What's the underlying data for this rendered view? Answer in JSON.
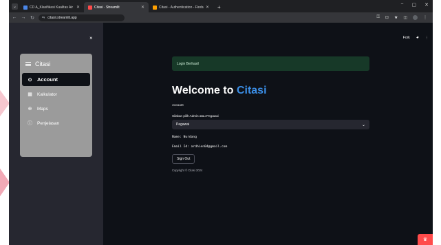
{
  "browser": {
    "tabs": [
      {
        "label": "CD A_Klasifikasi Kualitas Air Su..",
        "fav_color": "#4a86e8",
        "active": false
      },
      {
        "label": "Citasi · Streamlit",
        "fav_color": "#ff4b4b",
        "active": true
      },
      {
        "label": "Citasi - Authentication - Fireba",
        "fav_color": "#ffa000",
        "active": false
      }
    ],
    "new_tab": "+",
    "url": "citasii.streamlit.app"
  },
  "sidebar": {
    "close": "×",
    "menu_title": "Citasi",
    "items": [
      {
        "label": "Account",
        "icon": "account-circle-icon",
        "glyph": "⊙",
        "active": true
      },
      {
        "label": "Kalkulator",
        "icon": "calculator-icon",
        "glyph": "▦",
        "active": false
      },
      {
        "label": "Maps",
        "icon": "globe-icon",
        "glyph": "⊕",
        "active": false
      },
      {
        "label": "Penjelasan",
        "icon": "info-icon",
        "glyph": "ⓘ",
        "active": false
      }
    ]
  },
  "header": {
    "fork": "Fork"
  },
  "main": {
    "alert": "Login Berhasil",
    "title_prefix": "Welcome to ",
    "title_brand": "Citasi",
    "section": "Account",
    "status_label": "Silakan pilih Admin atau Pegawai",
    "status_value": "Pegawai",
    "name_line": "Name: Nurdang",
    "email_line": "Email Id: ardhien04@gmail.com",
    "sign_out": "Sign Out",
    "copyright": "Copyright © Citasi 2024"
  },
  "colors": {
    "app_bg": "#0e1117",
    "sidebar_bg": "#262730",
    "brand": "#3b8ee6",
    "alert_bg": "#173928",
    "menu_card": "#9b9b9b",
    "deploy": "#ff4b4b"
  }
}
